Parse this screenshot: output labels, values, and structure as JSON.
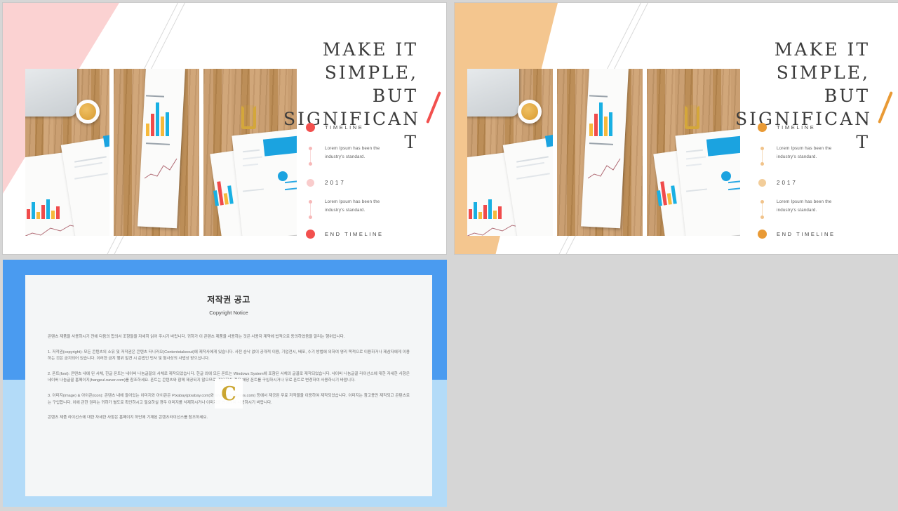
{
  "theme": {
    "canvas_bg": "#d6d6d6",
    "slide_bg": "#ffffff",
    "doc_blue_top": "#4a9bf0",
    "doc_blue_bottom": "#b3dbf8",
    "doc_page_bg": "#f4f6f7"
  },
  "slides": [
    {
      "name": "slide-pink",
      "wedge_color": "#fbd2d2",
      "accent": "#f2504e",
      "accent_soft": "#fbc0c0",
      "accent_faint": "#f9d9d9",
      "headline": "MAKE IT SIMPLE, BUT SIGNIFICANT",
      "headline_lines": [
        "MAKE IT",
        "SIMPLE,",
        "BUT",
        "SIGNIFICAN",
        "T"
      ],
      "timeline": {
        "start_label": "TIMELINE",
        "end_label": "END TIMELINE",
        "year": "2017",
        "body_line_1": "Lorem  Ipsum has been the",
        "body_line_2": "industry's standard."
      }
    },
    {
      "name": "slide-orange",
      "wedge_color": "#f4c68f",
      "accent": "#e99a35",
      "accent_soft": "#f1c38a",
      "accent_faint": "#f6ddbd",
      "headline": "MAKE IT SIMPLE, BUT SIGNIFICANT",
      "headline_lines": [
        "MAKE IT",
        "SIMPLE,",
        "BUT",
        "SIGNIFICAN",
        "T"
      ],
      "timeline": {
        "start_label": "TIMELINE",
        "end_label": "END TIMELINE",
        "year": "2017",
        "body_line_1": "Lorem  Ipsum has been the",
        "body_line_2": "industry's standard."
      }
    }
  ],
  "document": {
    "title_ko": "저작권 공고",
    "title_en": "Copyright Notice",
    "watermark_letter": "C",
    "paragraphs": [
      "콘텐츠 제품을 사용하시기 전에 다음의 합의서 조항들을 자세히 읽어 주시기 바랍니다. 귀하가 이 콘텐츠 제품을 사용하는 것은 사용자 계약에 법적으로 동의하였음을 알리는 행위입니다.",
      "1. 저작권(copyright): 모든 콘텐츠의 소유 및 저작권은 콘텐츠 타니러오(Contentstakeout)에 제작사에게 있습니다. 사전 승낙 없이 공개적 이용, 기업전시, 배포, 수기 방법에 의하여 영리 목적으로 이용하거나 제삼자에게 이용하는 것은 금지되어 있습니다. 이러한 금지 행위 발견 시 준법인 민사 및 형사상의 사법상 받으십니다.",
      "2. 폰트(font): 콘텐츠 내에 된 서체, 한글 폰트는 네이버 나눔글꼴의 서체로 제작되었습니다. 한글 외에 모든 폰트는 Windows System에 포함된 서체의 글꼴로 제작되었습니다. 네이버 나눔글꼴 라이선스에 대한 자세한 사항은 네이버 나눔글꼴 홈페이지(hangeul.naver.com)를 참조하세요. 폰트는 콘텐츠와 함께 제공되지 않으므로, 필요하실 경우 해당 폰트를 구입하시거나 무료 폰트로 변경하여 사용하시기 바랍니다.",
      "3. 이미지(image) & 아이콘(icon): 콘텐츠 내에 들어있는 이미지와 아이콘은 Pixabay(pixabay.com)와 Webalys(webalys.com) 등에서 제공된 무료 저작물을 이용하여 제작되었습니다. 이미지는 참고용만 제작되고 콘텐츠로는 구입합니다. 이에 관한 권리는 귀하가 별도로 확인하시고 필요하실 경우 이미지를 삭제하시거나 이미지를 변경하여 사용하시기 바랍니다.",
      "콘텐츠 제품 라이선스에 대한 자세한 사항은 홈페이지 하단에 기재된 콘텐츠라이선스를 참조하세요."
    ]
  }
}
